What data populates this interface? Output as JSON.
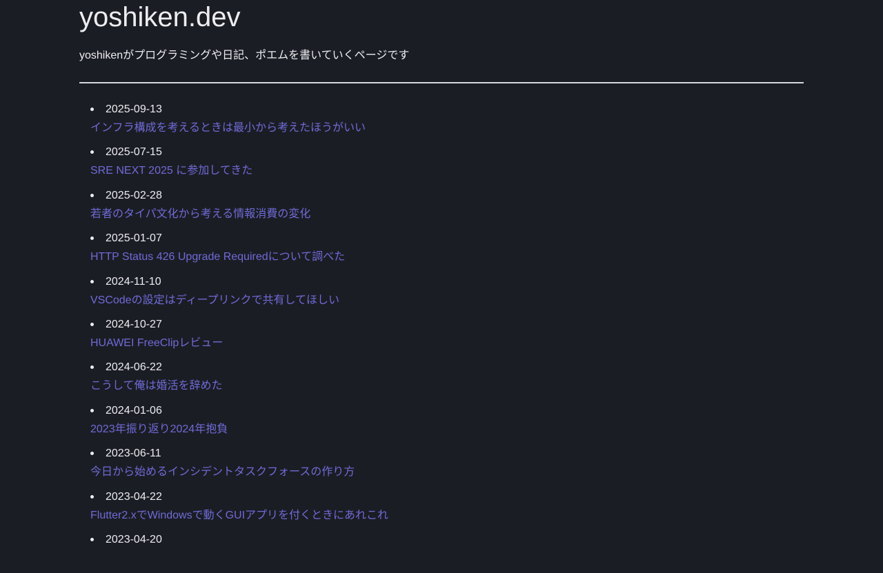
{
  "site": {
    "title": "yoshiken.dev",
    "tagline": "yoshikenがプログラミングや日記、ポエムを書いていくページです"
  },
  "posts": [
    {
      "date": "2025-09-13",
      "title": "インフラ構成を考えるときは最小から考えたほうがいい"
    },
    {
      "date": "2025-07-15",
      "title": "SRE NEXT 2025 に参加してきた"
    },
    {
      "date": "2025-02-28",
      "title": "若者のタイパ文化から考える情報消費の変化"
    },
    {
      "date": "2025-01-07",
      "title": "HTTP Status 426 Upgrade Requiredについて調べた"
    },
    {
      "date": "2024-11-10",
      "title": "VSCodeの設定はディープリンクで共有してほしい"
    },
    {
      "date": "2024-10-27",
      "title": "HUAWEI FreeClipレビュー"
    },
    {
      "date": "2024-06-22",
      "title": "こうして俺は婚活を辞めた"
    },
    {
      "date": "2024-01-06",
      "title": "2023年振り返り2024年抱負"
    },
    {
      "date": "2023-06-11",
      "title": "今日から始めるインシデントタスクフォースの作り方"
    },
    {
      "date": "2023-04-22",
      "title": "Flutter2.xでWindowsで動くGUIアプリを付くときにあれこれ"
    },
    {
      "date": "2023-04-20",
      "title": ""
    }
  ],
  "colors": {
    "background": "#1b1d25",
    "text": "#ededf0",
    "link": "#6f6bd6"
  }
}
